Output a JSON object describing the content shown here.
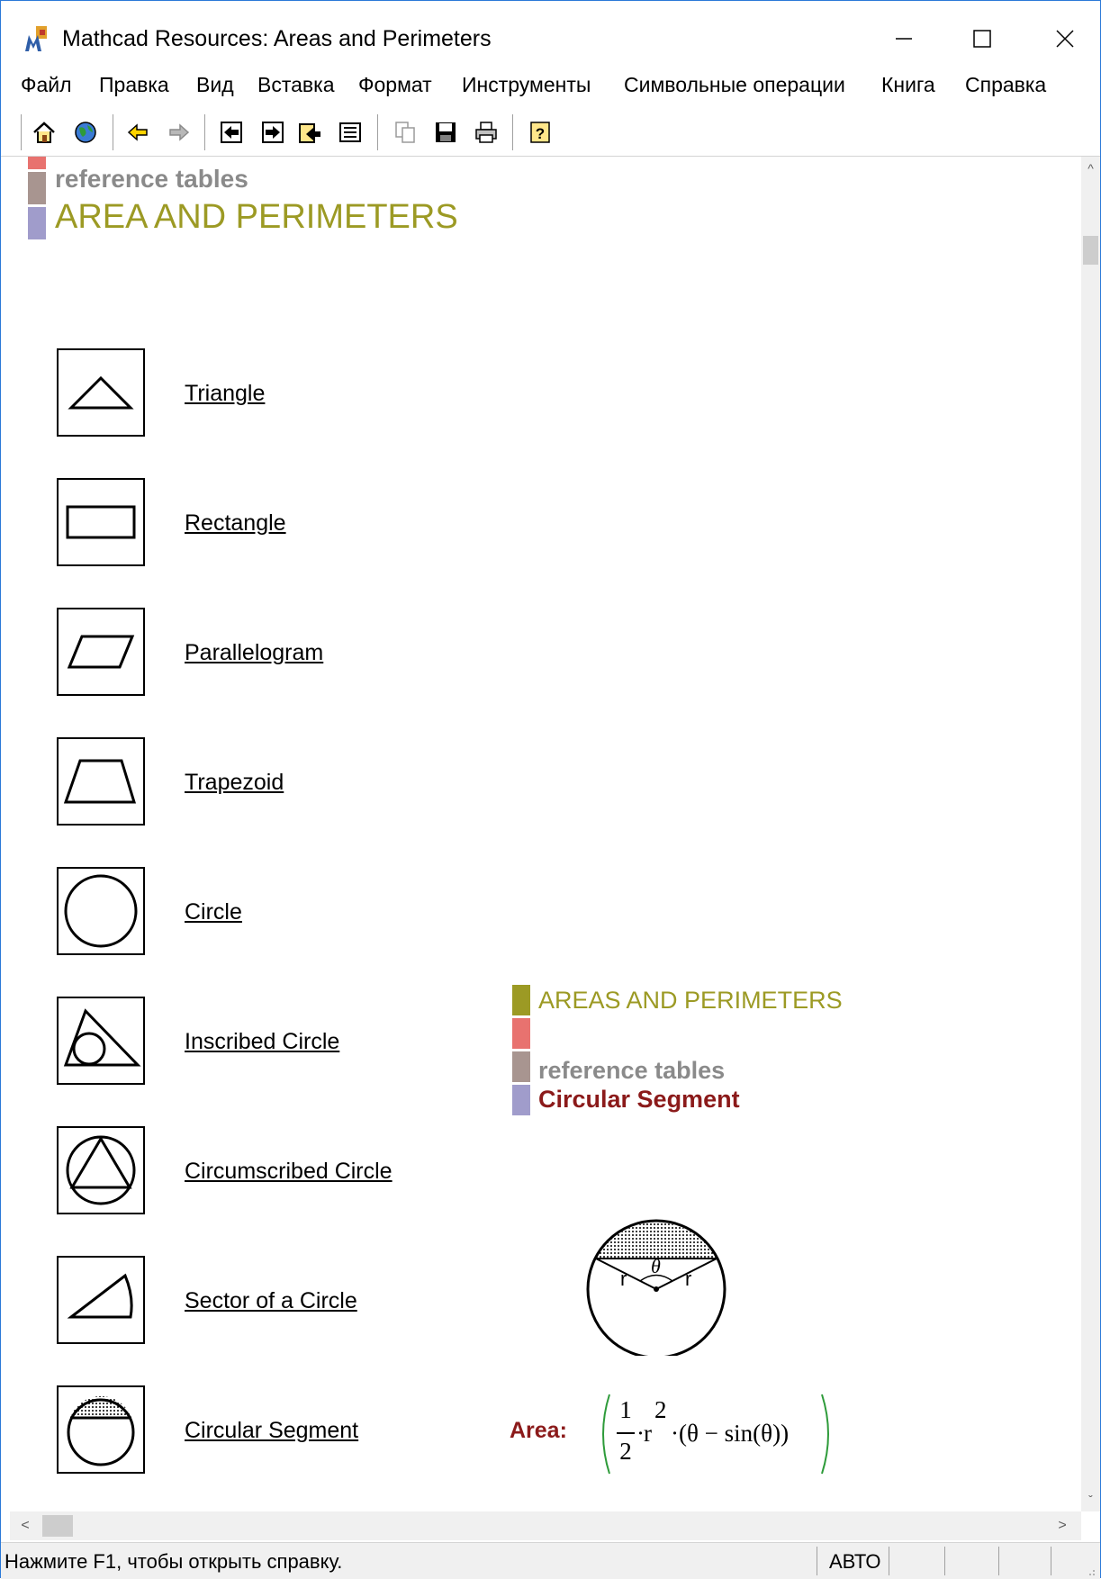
{
  "window": {
    "title": "Mathcad Resources: Areas and Perimeters"
  },
  "menu": [
    {
      "label": "Файл"
    },
    {
      "label": "Правка"
    },
    {
      "label": "Вид"
    },
    {
      "label": "Вставка"
    },
    {
      "label": "Формат"
    },
    {
      "label": "Инструменты"
    },
    {
      "label": "Символьные операции"
    },
    {
      "label": "Книга"
    },
    {
      "label": "Справка"
    }
  ],
  "toolbar": {
    "buttons": [
      "home-icon",
      "globe-icon",
      "back-icon",
      "forward-icon",
      "prev-page-icon",
      "next-page-icon",
      "up-page-icon",
      "bookmark-icon",
      "copy-icon",
      "save-icon",
      "print-icon",
      "help-icon"
    ]
  },
  "header": {
    "ref_label": "reference tables",
    "title": "AREA AND PERIMETERS",
    "colors": {
      "top": "#e8726f",
      "mid": "#a89590",
      "low": "#a09ccb",
      "olive": "#9c9a24"
    }
  },
  "shapes": [
    {
      "label": "Triangle",
      "icon": "triangle-icon"
    },
    {
      "label": "Rectangle",
      "icon": "rectangle-icon"
    },
    {
      "label": "Parallelogram",
      "icon": "parallelogram-icon"
    },
    {
      "label": "Trapezoid",
      "icon": "trapezoid-icon"
    },
    {
      "label": "Circle",
      "icon": "circle-icon"
    },
    {
      "label": "Inscribed Circle",
      "icon": "inscribed-circle-icon"
    },
    {
      "label": "Circumscribed Circle",
      "icon": "circumscribed-circle-icon"
    },
    {
      "label": "Sector of a Circle",
      "icon": "sector-icon"
    },
    {
      "label": "Circular Segment",
      "icon": "circular-segment-icon"
    }
  ],
  "panel": {
    "title": "AREAS AND PERIMETERS",
    "ref_label": "reference tables",
    "subtitle": "Circular Segment",
    "diagram": {
      "r_label": "r",
      "theta_label": "θ"
    },
    "area_label": "Area:",
    "formula": {
      "num": "1",
      "den": "2",
      "r": "r",
      "exp": "2",
      "tail": "·(θ − sin(θ))"
    }
  },
  "status": {
    "text": "Нажмите F1, чтобы открыть справку.",
    "mode": "АВТО"
  }
}
